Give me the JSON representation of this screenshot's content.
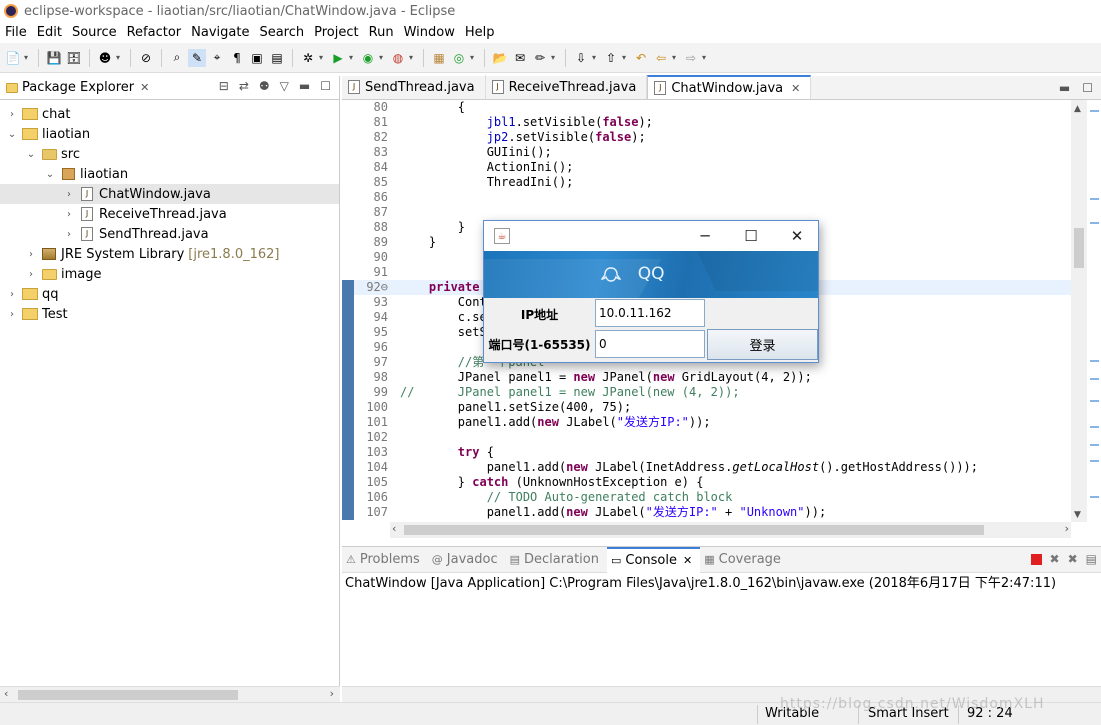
{
  "window": {
    "title": "eclipse-workspace - liaotian/src/liaotian/ChatWindow.java - Eclipse"
  },
  "menu": [
    "File",
    "Edit",
    "Source",
    "Refactor",
    "Navigate",
    "Search",
    "Project",
    "Run",
    "Window",
    "Help"
  ],
  "package_explorer": {
    "tab_label": "Package Explorer",
    "tree": [
      {
        "label": "chat",
        "indent": 0,
        "arrow": "›",
        "icon": "project"
      },
      {
        "label": "liaotian",
        "indent": 0,
        "arrow": "⌄",
        "icon": "project"
      },
      {
        "label": "src",
        "indent": 1,
        "arrow": "⌄",
        "icon": "src-folder"
      },
      {
        "label": "liaotian",
        "indent": 2,
        "arrow": "⌄",
        "icon": "package"
      },
      {
        "label": "ChatWindow.java",
        "indent": 3,
        "arrow": "›",
        "icon": "java-file",
        "selected": true
      },
      {
        "label": "ReceiveThread.java",
        "indent": 3,
        "arrow": "›",
        "icon": "java-file"
      },
      {
        "label": "SendThread.java",
        "indent": 3,
        "arrow": "›",
        "icon": "java-file"
      },
      {
        "label": "JRE System Library",
        "suffix": "[jre1.8.0_162]",
        "indent": 1,
        "arrow": "›",
        "icon": "library"
      },
      {
        "label": "image",
        "indent": 1,
        "arrow": "›",
        "icon": "folder"
      },
      {
        "label": "qq",
        "indent": 0,
        "arrow": "›",
        "icon": "project"
      },
      {
        "label": "Test",
        "indent": 0,
        "arrow": "›",
        "icon": "project"
      }
    ]
  },
  "editor": {
    "tabs": [
      {
        "label": "SendThread.java",
        "active": false
      },
      {
        "label": "ReceiveThread.java",
        "active": false
      },
      {
        "label": "ChatWindow.java",
        "active": true
      }
    ],
    "lines": [
      {
        "n": "80",
        "html": "        {"
      },
      {
        "n": "81",
        "html": "            <span class='fld'>jbl1</span>.setVisible(<span class='kw'>false</span>);"
      },
      {
        "n": "82",
        "html": "            <span class='fld'>jp2</span>.setVisible(<span class='kw'>false</span>);"
      },
      {
        "n": "83",
        "html": "            GUIini();"
      },
      {
        "n": "84",
        "html": "            ActionIni();"
      },
      {
        "n": "85",
        "html": "            ThreadIni();"
      },
      {
        "n": "86",
        "html": ""
      },
      {
        "n": "87",
        "html": ""
      },
      {
        "n": "88",
        "html": "        }"
      },
      {
        "n": "89",
        "html": "    }"
      },
      {
        "n": "90",
        "html": ""
      },
      {
        "n": "91",
        "html": ""
      },
      {
        "n": "92⊖",
        "html": "    <span class='kw'>private</span> <span class='kw'>vo</span>",
        "mark": true,
        "hl": true
      },
      {
        "n": "93",
        "html": "        Conta",
        "mark": true
      },
      {
        "n": "94",
        "html": "        c.set",
        "mark": true
      },
      {
        "n": "95",
        "html": "        setSi",
        "mark": true
      },
      {
        "n": "96",
        "html": "",
        "mark": true
      },
      {
        "n": "97",
        "html": "        <span class='cmt'>//第一个panel</span>",
        "mark": true
      },
      {
        "n": "98",
        "html": "        JPanel panel1 = <span class='kw'>new</span> JPanel(<span class='kw'>new</span> GridLayout(4, 2));",
        "mark": true
      },
      {
        "n": "99",
        "html": "<span class='cmt'>//      JPanel panel1 = new JPanel(new (4, 2));</span>",
        "mark": true
      },
      {
        "n": "100",
        "html": "        panel1.setSize(400, 75);",
        "mark": true
      },
      {
        "n": "101",
        "html": "        panel1.add(<span class='kw'>new</span> JLabel(<span class='str'>\"发送方IP:\"</span>));",
        "mark": true
      },
      {
        "n": "102",
        "html": "",
        "mark": true
      },
      {
        "n": "103",
        "html": "        <span class='kw'>try</span> {",
        "mark": true
      },
      {
        "n": "104",
        "html": "            panel1.add(<span class='kw'>new</span> JLabel(InetAddress.<span class='it'>getLocalHost</span>().getHostAddress()));",
        "mark": true
      },
      {
        "n": "105",
        "html": "        } <span class='kw'>catch</span> (UnknownHostException e) {",
        "mark": true
      },
      {
        "n": "106",
        "html": "            <span class='cmt'>// TODO Auto-generated catch block</span>",
        "mark": true
      },
      {
        "n": "107",
        "html": "            panel1.add(<span class='kw'>new</span> JLabel(<span class='str'>\"发送方IP:\"</span> + <span class='str'>\"Unknown\"</span>));",
        "mark": true
      }
    ]
  },
  "bottom": {
    "tabs": [
      {
        "label": "Problems",
        "icon": "problems-icon",
        "glyph": "⚠"
      },
      {
        "label": "Javadoc",
        "icon": "javadoc-icon",
        "glyph": "@"
      },
      {
        "label": "Declaration",
        "icon": "declaration-icon",
        "glyph": "▤"
      },
      {
        "label": "Console",
        "icon": "console-icon",
        "glyph": "▭",
        "active": true
      },
      {
        "label": "Coverage",
        "icon": "coverage-icon",
        "glyph": "▦"
      }
    ],
    "console_text": "ChatWindow [Java Application] C:\\Program Files\\Java\\jre1.8.0_162\\bin\\javaw.exe (2018年6月17日 下午2:47:11)"
  },
  "status": {
    "writable": "Writable",
    "insert_mode": "Smart Insert",
    "position": "92 : 24"
  },
  "watermark": "https://blog.csdn.net/WisdomXLH",
  "dialog": {
    "banner_logo": "QQ",
    "ip_label": "IP地址",
    "ip_value": "10.0.11.162",
    "port_label": "端口号(1-65535)",
    "port_value": "0",
    "login_label": "登录"
  },
  "colors": {
    "accent": "#3d7ed8",
    "banner": "#1b74b9"
  }
}
